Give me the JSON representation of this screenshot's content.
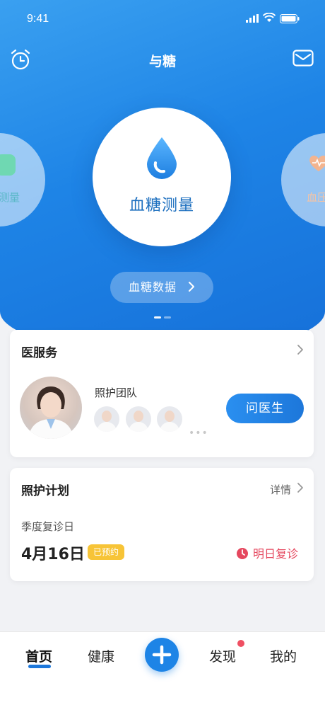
{
  "status_bar": {
    "time": "9:41"
  },
  "header": {
    "title": "与糖"
  },
  "carousel": {
    "left_item_label": "测量",
    "center_item_label": "血糖测量",
    "right_item_label": "血压",
    "data_button_label": "血糖数据"
  },
  "medical_service": {
    "title": "医服务",
    "team_label": "照护团队",
    "ask_button_label": "问医生"
  },
  "care_plan": {
    "title": "照护计划",
    "detail_label": "详情",
    "subtitle": "季度复诊日",
    "date": "4月16日",
    "badge": "已预约",
    "reminder": "明日复诊"
  },
  "tabbar": {
    "home": "首页",
    "health": "健康",
    "discover": "发现",
    "mine": "我的"
  },
  "colors": {
    "primary": "#1d84e6",
    "badge": "#f7c437",
    "alert": "#e5475e"
  }
}
